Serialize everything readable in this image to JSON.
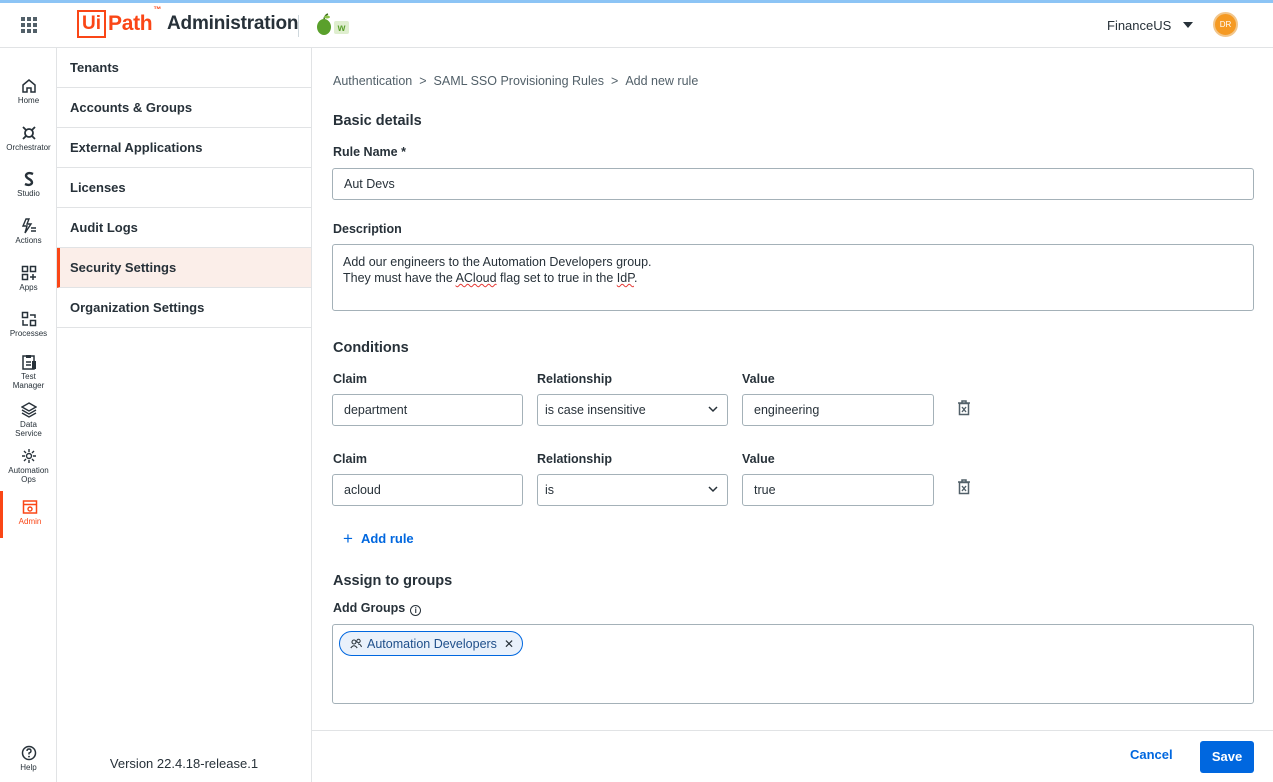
{
  "header": {
    "app_title": "Administration",
    "logo_ui": "Ui",
    "logo_path": "Path",
    "logo_tm": "™",
    "tenant_badge": "w",
    "org_name": "FinanceUS",
    "avatar_initials": "DR"
  },
  "rail": {
    "items": [
      {
        "label": "Home"
      },
      {
        "label": "Orchestrator"
      },
      {
        "label": "Studio"
      },
      {
        "label": "Actions"
      },
      {
        "label": "Apps"
      },
      {
        "label": "Processes"
      },
      {
        "label": "Test",
        "label2": "Manager"
      },
      {
        "label": "Data",
        "label2": "Service"
      },
      {
        "label": "Automation",
        "label2": "Ops"
      },
      {
        "label": "Admin"
      },
      {
        "label": "Help"
      }
    ]
  },
  "subnav": {
    "items": [
      {
        "label": "Tenants"
      },
      {
        "label": "Accounts & Groups"
      },
      {
        "label": "External Applications"
      },
      {
        "label": "Licenses"
      },
      {
        "label": "Audit Logs"
      },
      {
        "label": "Security Settings"
      },
      {
        "label": "Organization Settings"
      }
    ],
    "version": "Version 22.4.18-release.1"
  },
  "breadcrumb": [
    "Authentication",
    "SAML SSO Provisioning Rules",
    "Add new rule"
  ],
  "breadcrumb_sep": ">",
  "basic": {
    "title": "Basic details",
    "rule_name_label": "Rule Name *",
    "rule_name_value": "Aut Devs",
    "description_label": "Description",
    "description_line1": "Add our engineers to the Automation Developers group.",
    "description_line2_a": "They must have the ",
    "description_line2_b": "ACloud",
    "description_line2_c": " flag set to true in the ",
    "description_line2_d": "IdP",
    "description_line2_e": "."
  },
  "conditions": {
    "title": "Conditions",
    "rows": [
      {
        "claim_label": "Claim",
        "relationship_label": "Relationship",
        "value_label": "Value",
        "claim": "department",
        "relationship": "is case insensitive",
        "value": "engineering"
      },
      {
        "claim_label": "Claim",
        "relationship_label": "Relationship",
        "value_label": "Value",
        "claim": "acloud",
        "relationship": "is",
        "value": "true"
      }
    ],
    "add_rule": "Add rule",
    "add_rule_plus": "+"
  },
  "groups": {
    "title": "Assign to groups",
    "add_label": "Add Groups",
    "info_glyph": "i",
    "chips": [
      {
        "label": "Automation Developers"
      }
    ],
    "chip_remove": "✕"
  },
  "footer": {
    "cancel": "Cancel",
    "save": "Save"
  },
  "colors": {
    "brand": "#fa4616",
    "primary": "#0067df",
    "avatar": "#f59a23"
  }
}
